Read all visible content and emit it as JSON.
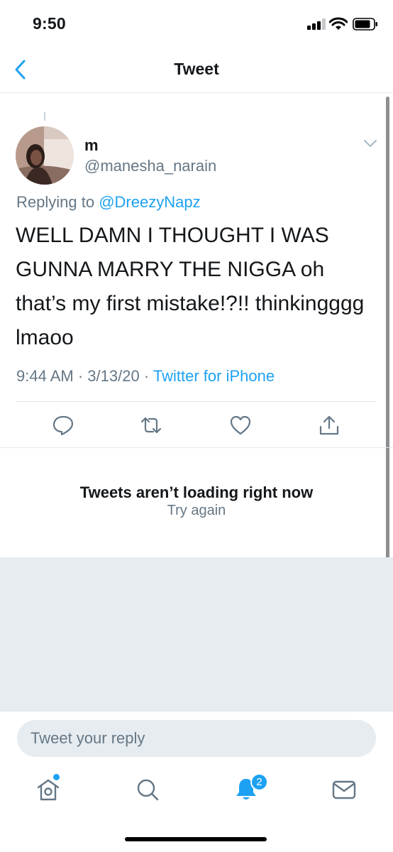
{
  "status_bar": {
    "time": "9:50"
  },
  "header": {
    "title": "Tweet"
  },
  "tweet": {
    "display_name": "m",
    "handle": "@manesha_narain",
    "replying_prefix": "Replying to",
    "replying_handle": "@DreezyNapz",
    "text": "WELL DAMN I THOUGHT I WAS GUNNA MARRY THE NIGGA oh that’s my first mistake!?!! thinkingggg lmaoo",
    "time": "9:44 AM",
    "date": "3/13/20",
    "source": "Twitter for iPhone"
  },
  "replies": {
    "empty_title": "Tweets aren’t loading right now",
    "retry_label": "Try again"
  },
  "composer": {
    "placeholder": "Tweet your reply"
  },
  "tabbar": {
    "notification_count": "2"
  },
  "colors": {
    "accent": "#1da1f2",
    "secondary_text": "#657786",
    "divider": "#e1e8ed",
    "gray_fill": "#e6ecf0"
  },
  "icons": [
    "back-chevron-icon",
    "caret-down-icon",
    "reply-icon",
    "retweet-icon",
    "like-icon",
    "share-icon",
    "home-icon",
    "search-icon",
    "notifications-icon",
    "messages-icon"
  ]
}
